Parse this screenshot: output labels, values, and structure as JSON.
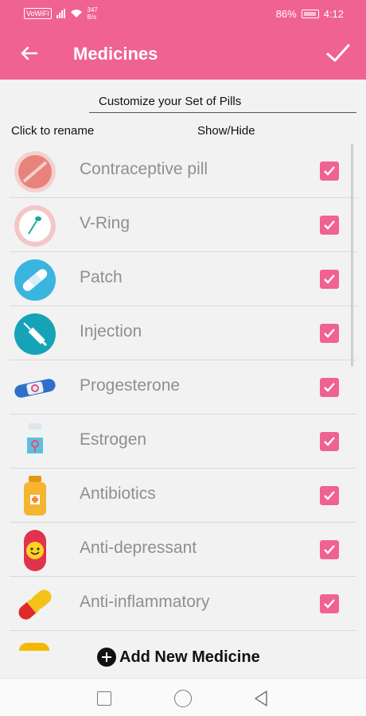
{
  "status_bar": {
    "carrier_badge": "VoWiFi",
    "net_speed_value": "347",
    "net_speed_unit": "B/s",
    "battery": "86%",
    "time": "4:12"
  },
  "app_bar": {
    "title": "Medicines",
    "back_icon": "arrow-left",
    "confirm_icon": "checkmark"
  },
  "subtitle": "Customize your Set of Pills",
  "columns": {
    "left": "Click to rename",
    "right": "Show/Hide"
  },
  "medicines": [
    {
      "name": "Contraceptive pill",
      "icon": "pill-icon",
      "checked": true
    },
    {
      "name": "V-Ring",
      "icon": "ring-icon",
      "checked": true
    },
    {
      "name": "Patch",
      "icon": "patch-icon",
      "checked": true
    },
    {
      "name": "Injection",
      "icon": "syringe-icon",
      "checked": true
    },
    {
      "name": "Progesterone",
      "icon": "capsule-icon",
      "checked": true
    },
    {
      "name": "Estrogen",
      "icon": "bottle-icon",
      "checked": true
    },
    {
      "name": "Antibiotics",
      "icon": "antibiotic-bottle-icon",
      "checked": true
    },
    {
      "name": "Anti-depressant",
      "icon": "smiley-pill-icon",
      "checked": true
    },
    {
      "name": "Anti-inflammatory",
      "icon": "capsule-red-yellow-icon",
      "checked": true
    }
  ],
  "add_button": "Add New Medicine",
  "colors": {
    "accent": "#f06292",
    "background": "#f2f2f2",
    "item_text": "#8f8f8f"
  }
}
